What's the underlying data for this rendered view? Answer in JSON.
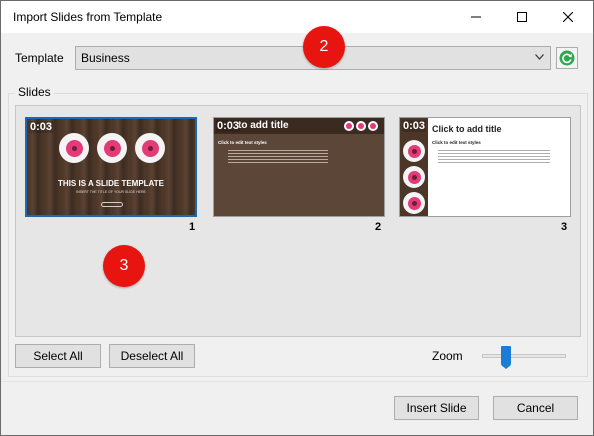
{
  "window": {
    "title": "Import Slides from Template",
    "controls": {
      "minimize_icon": "minimize-icon",
      "maximize_icon": "maximize-icon",
      "close_icon": "close-icon"
    }
  },
  "template": {
    "label": "Template",
    "selected": "Business",
    "refresh_icon": "refresh-icon"
  },
  "slides_group": {
    "label": "Slides",
    "slides": [
      {
        "number": "1",
        "timer": "0:03",
        "title": "THIS IS A SLIDE TEMPLATE",
        "subtitle": "INSERT THE TITLE\nOF YOUR SLIDE HERE",
        "selected": true
      },
      {
        "number": "2",
        "timer": "0:03",
        "title": "to add title",
        "subtitle": "Click to edit text styles",
        "selected": false
      },
      {
        "number": "3",
        "timer": "0:03",
        "title": "Click to add title",
        "subtitle": "Click to edit text styles",
        "selected": false
      }
    ]
  },
  "annotations": {
    "badge_2": "2",
    "badge_3": "3"
  },
  "buttons": {
    "select_all": "Select All",
    "deselect_all": "Deselect All",
    "insert_slide": "Insert Slide",
    "cancel": "Cancel"
  },
  "zoom": {
    "label": "Zoom",
    "level": 0.3
  },
  "colors": {
    "accent": "#1a69b5",
    "badge": "#e8140f",
    "donut": "#e43a78"
  }
}
